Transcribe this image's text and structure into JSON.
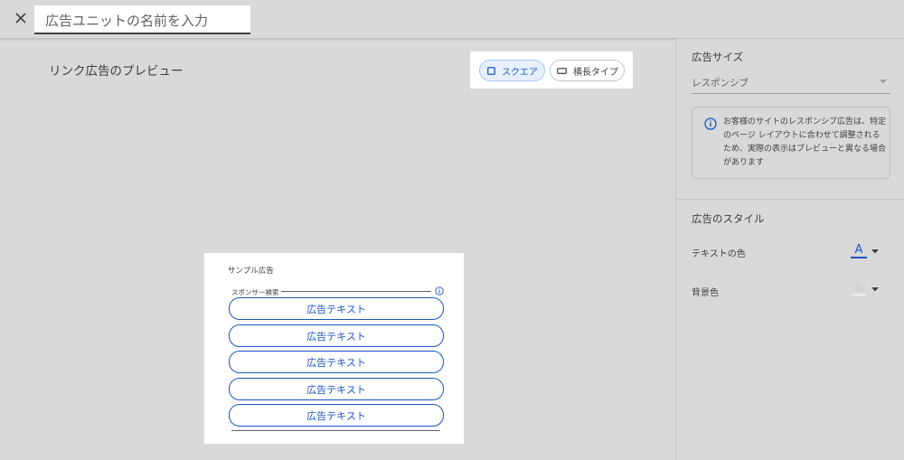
{
  "header": {
    "close_icon": "close-icon",
    "name_placeholder": "広告ユニットの名前を入力"
  },
  "preview": {
    "title": "リンク広告のプレビュー",
    "toggle": {
      "square_label": "スクエア",
      "wide_label": "横長タイプ",
      "selected": "スクエア"
    }
  },
  "ad": {
    "sample_label": "サンプル広告",
    "sponsor_label": "スポンサー検索",
    "buttons": [
      {
        "label": "広告テキスト"
      },
      {
        "label": "広告テキスト"
      },
      {
        "label": "広告テキスト"
      },
      {
        "label": "広告テキスト"
      },
      {
        "label": "広告テキスト"
      }
    ]
  },
  "sidebar": {
    "size_heading": "広告サイズ",
    "size_value": "レスポンシブ",
    "info_text": "お客様のサイトのレスポンシブ広告は、特定のページ レイアウトに合わせて調整されるため、実際の表示はプレビューと異なる場合があります",
    "style_heading": "広告のスタイル",
    "text_color_label": "テキストの色",
    "text_color_glyph": "A",
    "bg_color_label": "背景色"
  },
  "colors": {
    "accent": "#1a56c4",
    "background": "#d9d9d9",
    "text": "#3c4043"
  }
}
